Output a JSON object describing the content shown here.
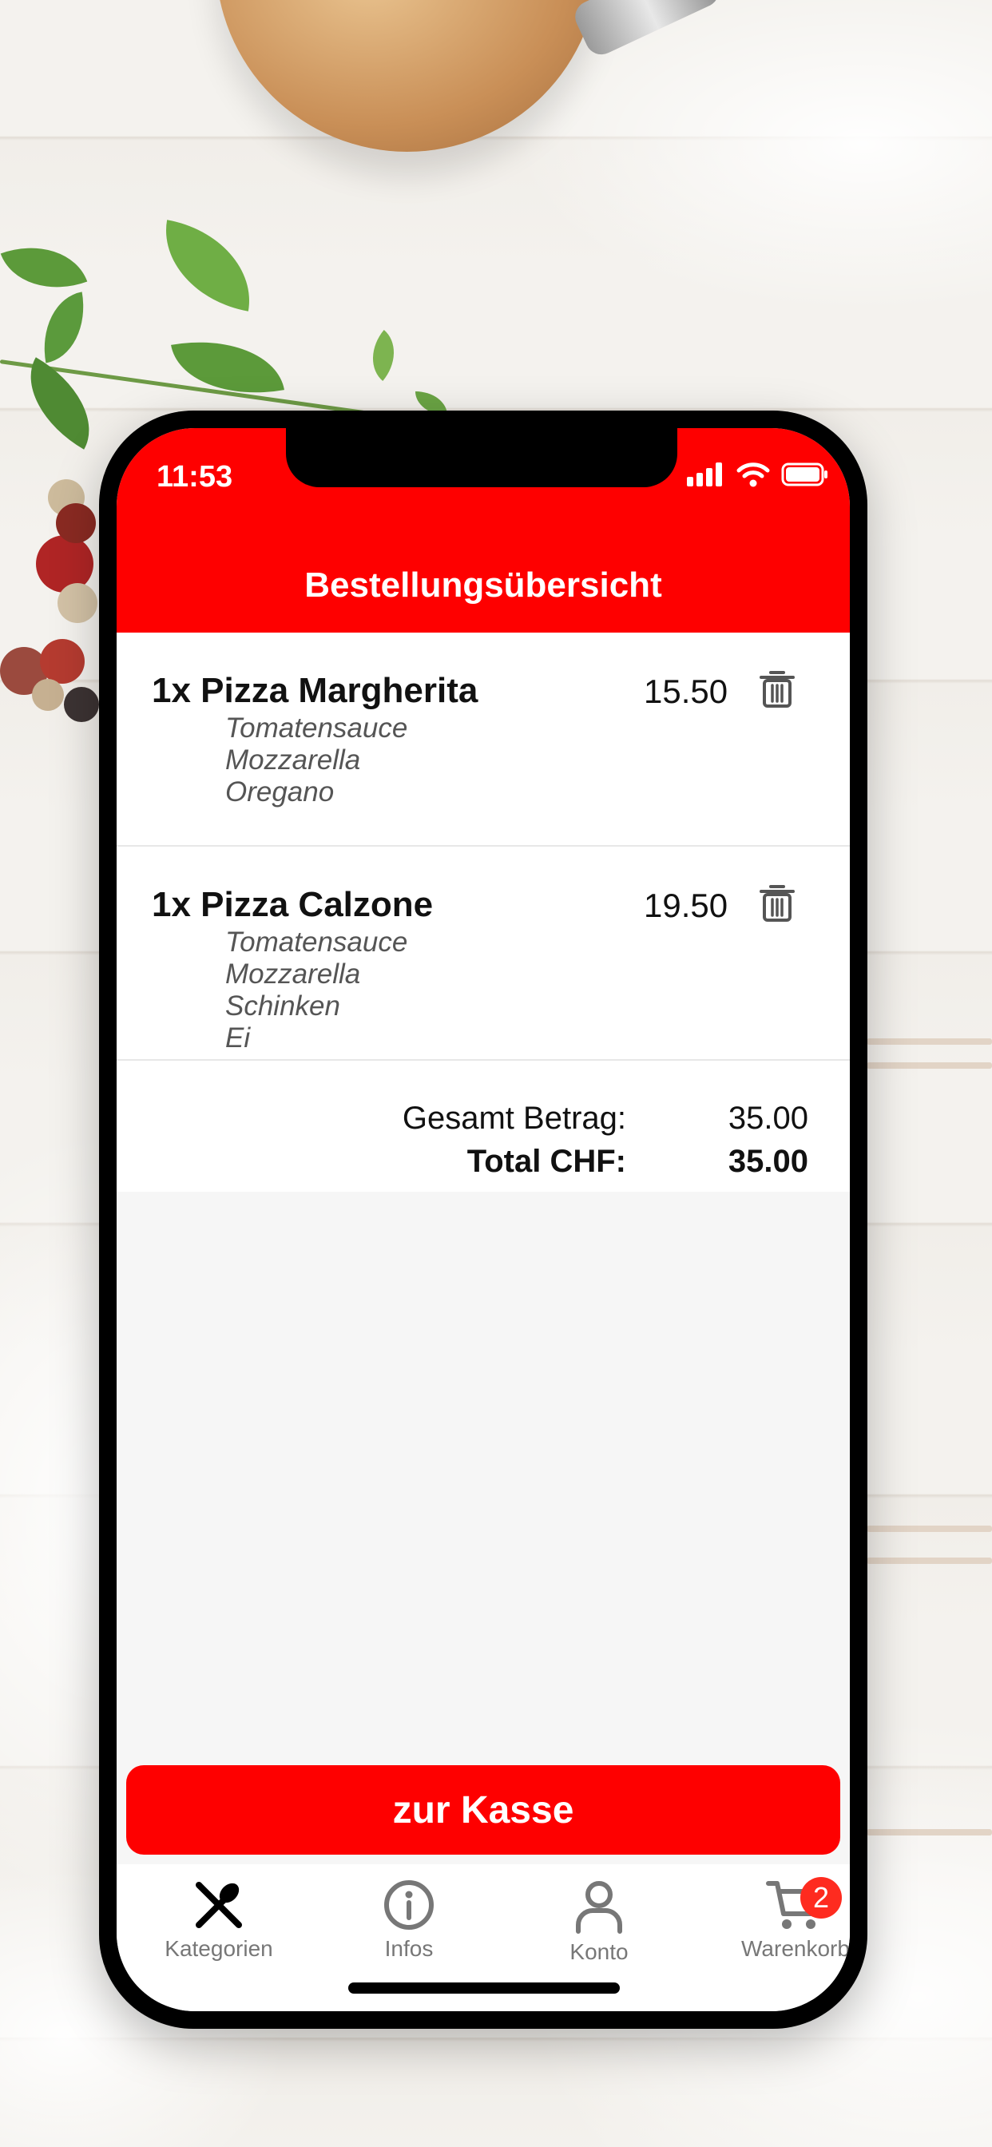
{
  "status_bar": {
    "time": "11:53"
  },
  "header": {
    "title": "Bestellungsübersicht"
  },
  "orders": [
    {
      "title": "1x Pizza Margherita",
      "price": "15.50",
      "ingredients": [
        "Tomatensauce",
        "Mozzarella",
        "Oregano"
      ]
    },
    {
      "title": "1x Pizza Calzone",
      "price": "19.50",
      "ingredients": [
        "Tomatensauce",
        "Mozzarella",
        "Schinken",
        "Ei"
      ]
    }
  ],
  "totals": {
    "subtotal_label": "Gesamt Betrag:",
    "subtotal_value": "35.00",
    "total_label": "Total CHF:",
    "total_value": "35.00"
  },
  "checkout_button": {
    "label": "zur Kasse"
  },
  "tabbar": {
    "tabs": [
      {
        "label": "Kategorien",
        "icon": "fork-spoon-icon",
        "active": true
      },
      {
        "label": "Infos",
        "icon": "info-icon"
      },
      {
        "label": "Konto",
        "icon": "user-icon"
      },
      {
        "label": "Warenkorb",
        "icon": "cart-icon",
        "badge": "2"
      }
    ]
  },
  "colors": {
    "brand_red": "#fe0000",
    "badge_red": "#fe2b1f",
    "tab_inactive": "#777777",
    "tab_active": "#000000"
  }
}
